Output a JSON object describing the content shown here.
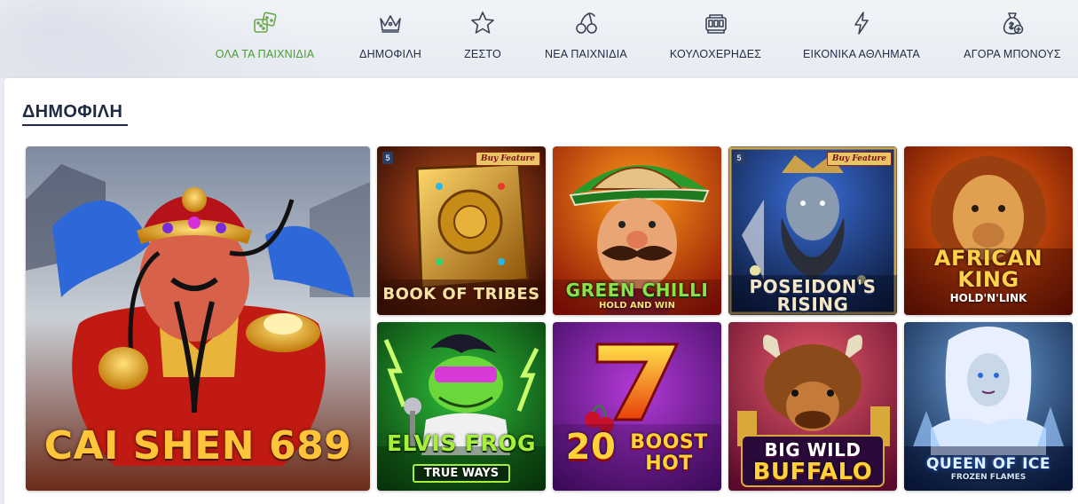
{
  "nav": {
    "items": [
      {
        "label": "ΟΛΑ ΤΑ ΠΑΙΧΝΙΔΙΑ",
        "icon": "dice-icon",
        "active": true
      },
      {
        "label": "ΔΗΜΟΦΙΛΗ",
        "icon": "crown-icon",
        "active": false
      },
      {
        "label": "ΖΕΣΤΟ",
        "icon": "star-icon",
        "active": false
      },
      {
        "label": "ΝΕΑ ΠΑΙΧΝΙΔΙΑ",
        "icon": "cherries-icon",
        "active": false
      },
      {
        "label": "ΚΟΥΛΟΧΕΡΗΔΕΣ",
        "icon": "slot-machine-icon",
        "active": false
      },
      {
        "label": "ΕΙΚΟΝΙΚΑ ΑΘΛΗΜΑΤΑ",
        "icon": "lightning-icon",
        "active": false
      },
      {
        "label": "ΑΓΟΡΑ ΜΠΟΝΟΥΣ",
        "icon": "money-bag-icon",
        "active": false
      }
    ],
    "active_color": "#4b9b35"
  },
  "section": {
    "title": "ΔΗΜΟΦΙΛΗ"
  },
  "games": [
    {
      "title": "CAI SHEN 689",
      "subtitle": ""
    },
    {
      "title": "BOOK OF TRIBES",
      "subtitle": "",
      "badge": "Buy Feature",
      "provider_mark": "5"
    },
    {
      "title": "GREEN CHILLI",
      "subtitle": "HOLD AND WIN"
    },
    {
      "title": "POSEIDON'S",
      "subtitle": "RISING",
      "badge": "Buy Feature",
      "provider_mark": "5"
    },
    {
      "title": "AFRICAN",
      "subtitle": "KING",
      "tagline": "HOLD'N'LINK"
    },
    {
      "title": "ELVIS FROG",
      "subtitle": "TRUE WAYS"
    },
    {
      "title": "20",
      "subtitle": "BOOST HOT"
    },
    {
      "title": "BIG WILD",
      "subtitle": "BUFFALO"
    },
    {
      "title": "QUEEN OF ICE",
      "subtitle": "FROZEN FLAMES"
    }
  ]
}
